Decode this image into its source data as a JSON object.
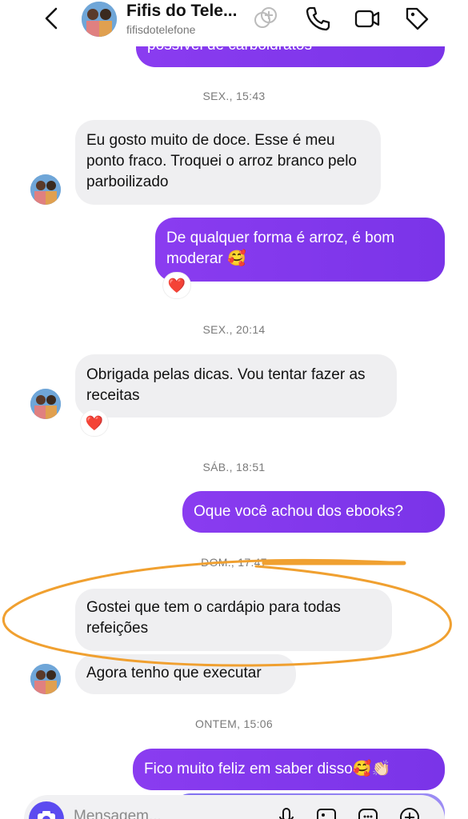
{
  "header": {
    "title": "Fifis do Tele...",
    "username": "fifisdotelefone"
  },
  "top_partial_message": "possível de carboidratos",
  "timestamps": {
    "t1": "SEX., 15:43",
    "t2": "SEX., 20:14",
    "t3": "SÁB., 18:51",
    "t4": "DOM., 17:47",
    "t5": "ONTEM, 15:06"
  },
  "messages": {
    "m1": "Eu gosto muito de doce. Esse é meu ponto fraco. Troquei o arroz branco pelo parboilizado",
    "m2": "De qualquer forma é arroz, é bom moderar 🥰",
    "m2_reaction": "❤️",
    "m3": "Obrigada pelas dicas. Vou tentar fazer as receitas",
    "m3_reaction": "❤️",
    "m4": "Oque você achou dos ebooks?",
    "m5": "Gostei que tem o cardápio para todas refeições",
    "m6": "Agora tenho que executar",
    "m7": "Fico muito feliz em saber disso🥰👏🏻"
  },
  "composer": {
    "placeholder": "Mensagem..."
  },
  "colors": {
    "outgoing": "#8a3cf0",
    "incoming": "#efeff1",
    "annotation": "#f0a030"
  }
}
